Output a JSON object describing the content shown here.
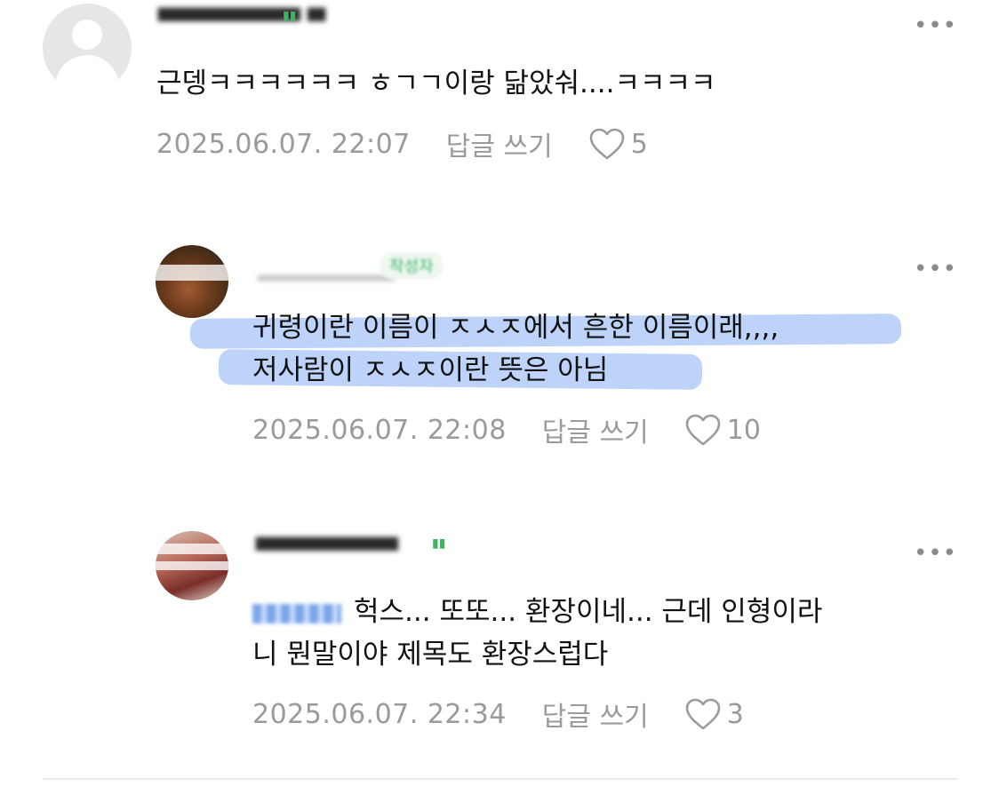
{
  "comments": [
    {
      "text": "근뎅ㅋㅋㅋㅋㅋㅋ ㅎㄱㄱ이랑 닮았숴....ㅋㅋㅋㅋ",
      "date": "2025.06.07. 22:07",
      "reply_label": "답글 쓰기",
      "likes": "5",
      "more": "•••"
    },
    {
      "badge": "작성자",
      "line1": "귀령이란 이름이 ㅈㅅㅈ에서 흔한 이름이래,,,,",
      "line2": "저사람이 ㅈㅅㅈ이란 뜻은 아님",
      "date": "2025.06.07. 22:08",
      "reply_label": "답글 쓰기",
      "likes": "10",
      "more": "•••"
    },
    {
      "line1": "헉스... 또또... 환장이네... 근데 인형이라",
      "line2": "니 뭔말이야 제목도 환장스럽다",
      "date": "2025.06.07. 22:34",
      "reply_label": "답글 쓰기",
      "likes": "3",
      "more": "•••"
    }
  ],
  "colors": {
    "highlight": "#87aff5",
    "meta_gray": "#9a9a9a",
    "badge_green": "#38b36a"
  },
  "icons": [
    "default-avatar-icon",
    "heart-icon",
    "more-icon"
  ]
}
